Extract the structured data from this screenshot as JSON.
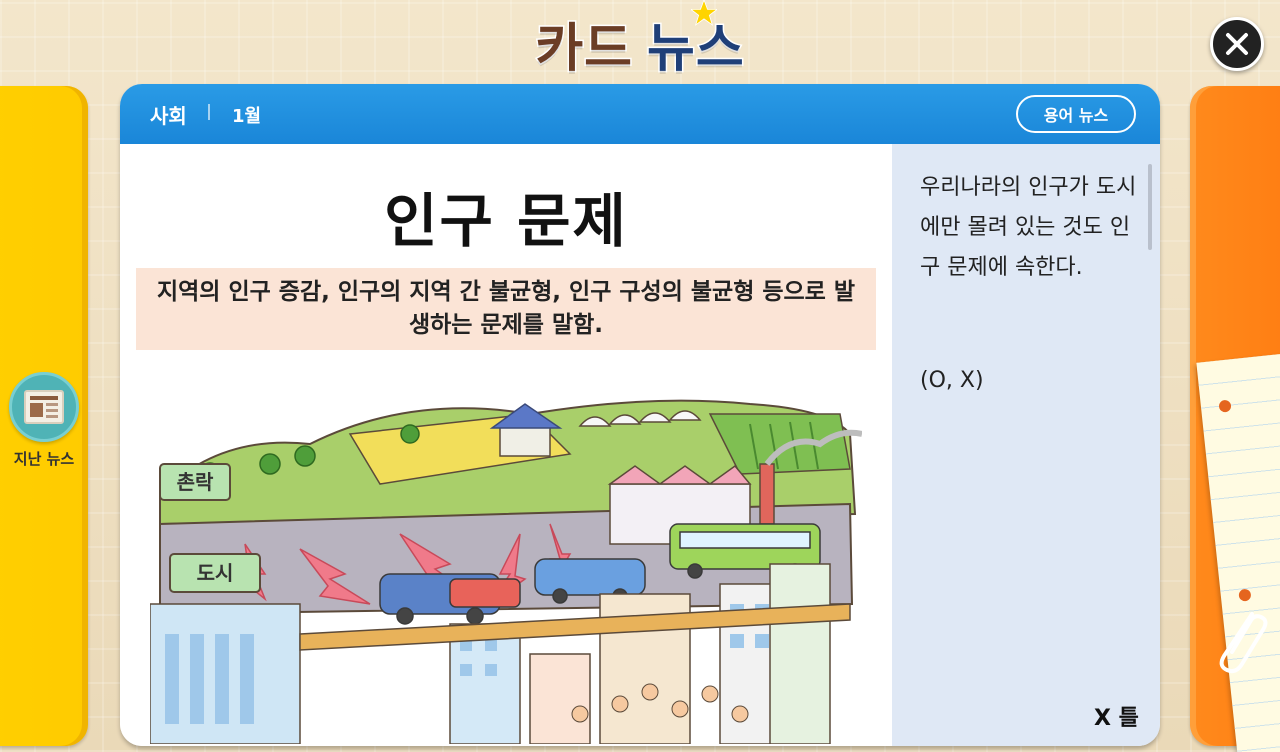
{
  "header": {
    "title_part1": "카드",
    "title_part2": "뉴스"
  },
  "left_panel": {
    "prev_news_label": "지난 뉴스"
  },
  "card": {
    "category": "사회",
    "month": "1월",
    "term_news_button": "용어 뉴스",
    "article": {
      "title": "인구 문제",
      "definition": "지역의 인구 증감, 인구의 지역 간 불균형, 인구 구성의 불균형 등으로 발생하는 문제를 말함.",
      "illustration_labels": {
        "village_sign": "촌락",
        "city_sign": "도시"
      }
    },
    "quiz": {
      "question": "우리나라의 인구가 도시에만 몰려 있는 것도 인구 문제에 속한다.",
      "options": "(O, X)",
      "result": "X 틀"
    }
  },
  "colors": {
    "header_blue": "#1a86d8",
    "left_card_yellow": "#ffcb00",
    "right_card_orange": "#ff7a10",
    "definition_bg": "#fbe4d6",
    "quiz_bg": "#dfe8f5"
  }
}
